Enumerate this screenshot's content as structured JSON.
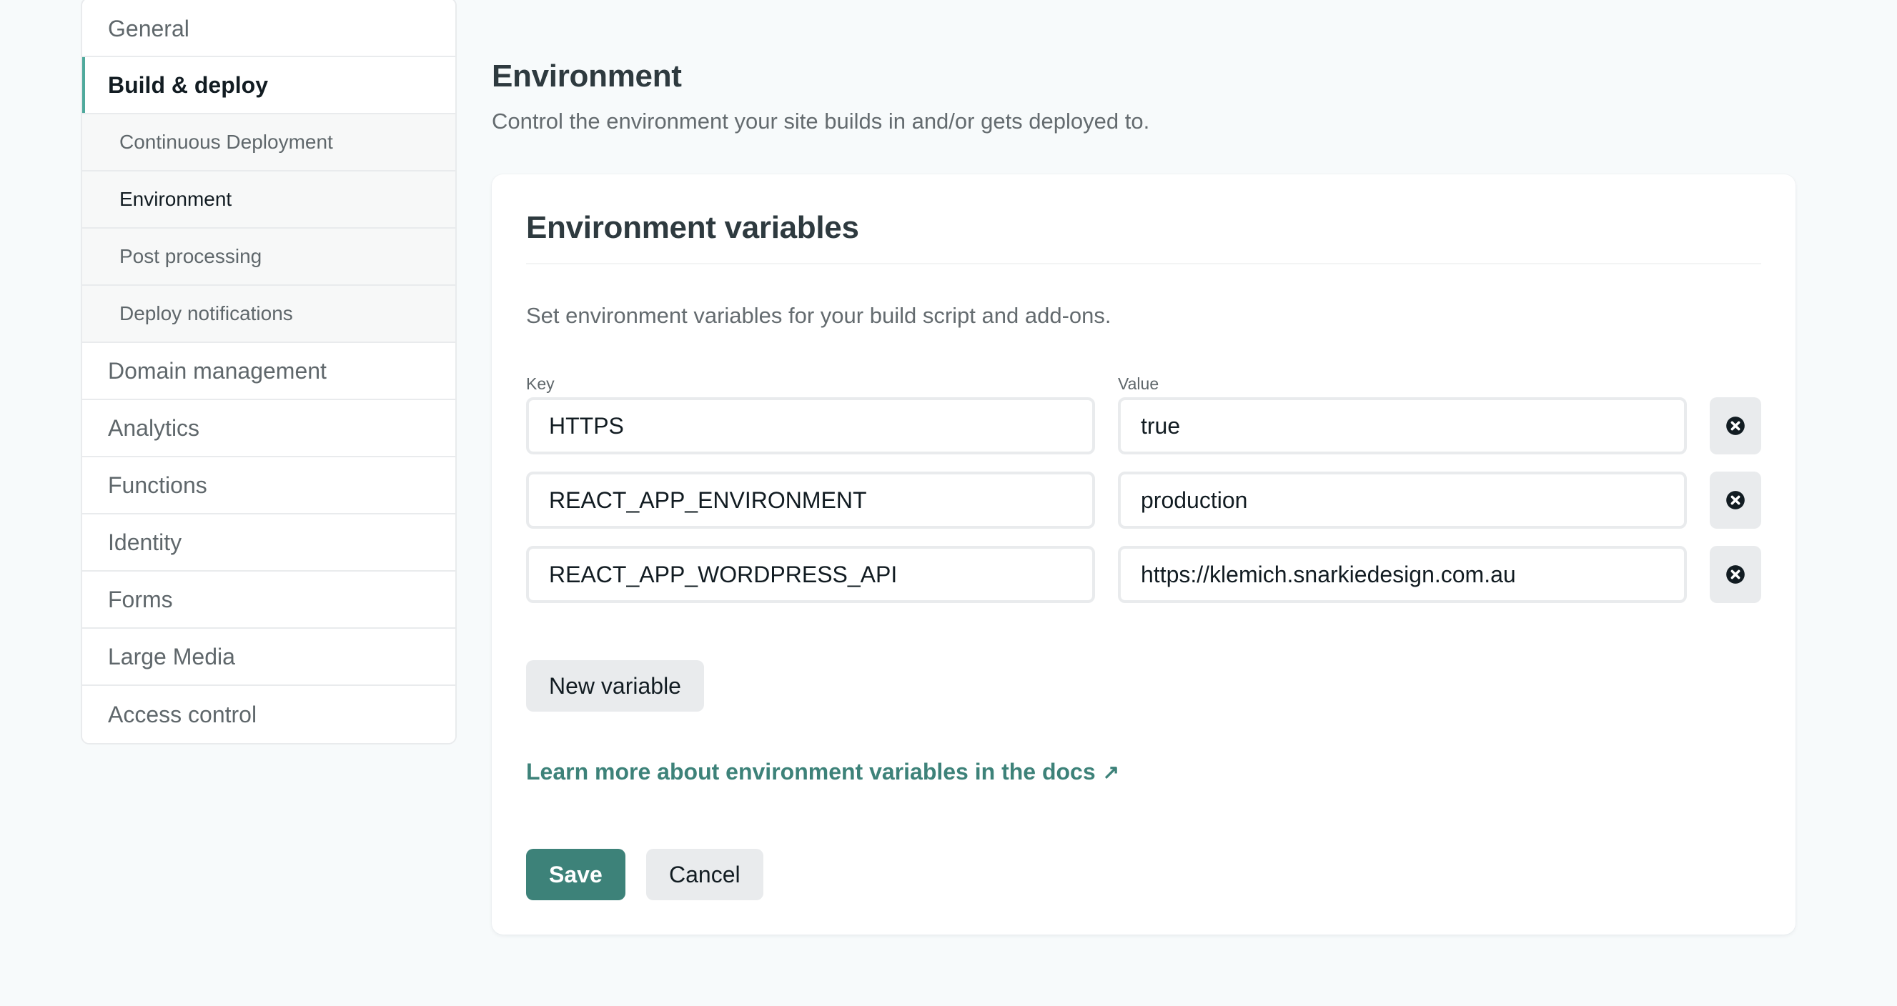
{
  "sidebar": {
    "items": [
      {
        "label": "General"
      },
      {
        "label": "Build & deploy"
      },
      {
        "label": "Continuous Deployment"
      },
      {
        "label": "Environment"
      },
      {
        "label": "Post processing"
      },
      {
        "label": "Deploy notifications"
      },
      {
        "label": "Domain management"
      },
      {
        "label": "Analytics"
      },
      {
        "label": "Functions"
      },
      {
        "label": "Identity"
      },
      {
        "label": "Forms"
      },
      {
        "label": "Large Media"
      },
      {
        "label": "Access control"
      }
    ],
    "active_section": "Build & deploy",
    "active_subsection": "Environment"
  },
  "header": {
    "title": "Environment",
    "subtitle": "Control the environment your site builds in and/or gets deployed to."
  },
  "card": {
    "title": "Environment variables",
    "description": "Set environment variables for your build script and add-ons.",
    "key_label": "Key",
    "value_label": "Value",
    "variables": [
      {
        "key": "HTTPS",
        "value": "true"
      },
      {
        "key": "REACT_APP_ENVIRONMENT",
        "value": "production"
      },
      {
        "key": "REACT_APP_WORDPRESS_API",
        "value": "https://klemich.snarkiedesign.com.au"
      }
    ],
    "delete_icon": "close-circle-icon",
    "new_variable_label": "New variable",
    "docs_link_label": "Learn more about environment variables in the docs",
    "docs_link_icon": "↗",
    "save_label": "Save",
    "cancel_label": "Cancel"
  },
  "colors": {
    "accent": "#3d8279",
    "active_indicator": "#4fa99c",
    "background": "#f7fafb",
    "text_primary": "#121c22",
    "text_secondary": "#646b6f"
  }
}
